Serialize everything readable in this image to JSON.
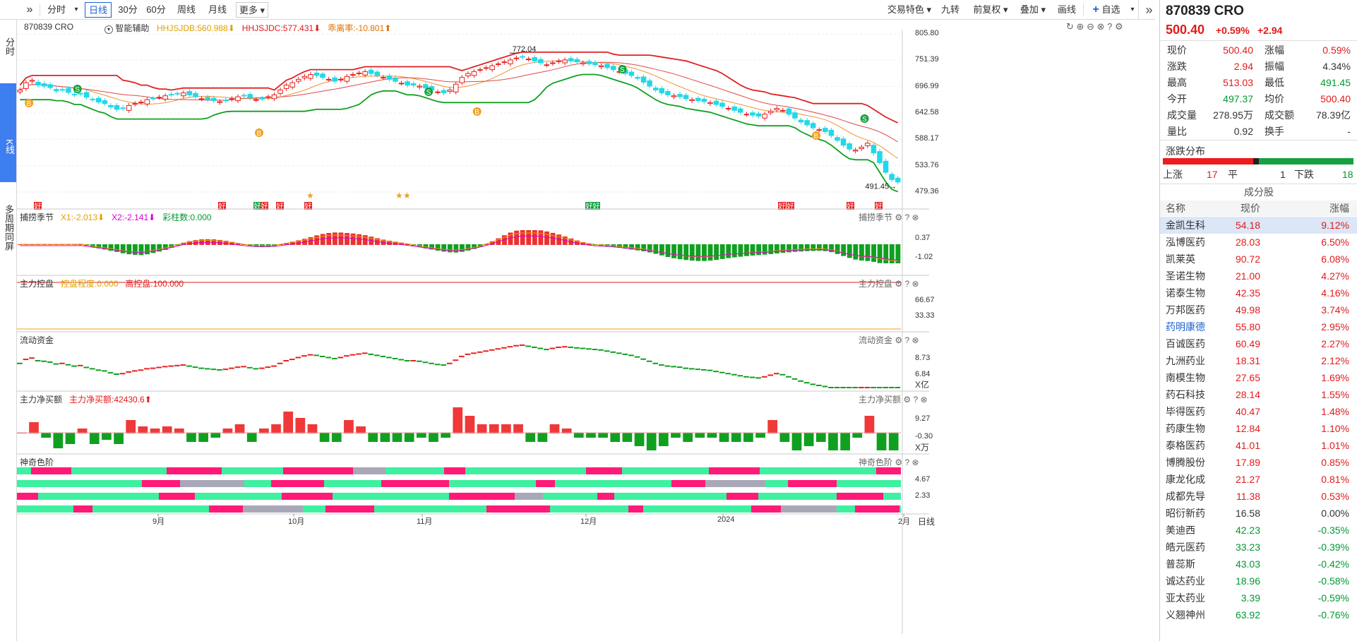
{
  "toolbar": {
    "expand_icon": "double-chevron-right-icon",
    "tabs": [
      {
        "label": "分时",
        "dropdown": true
      },
      {
        "label": "日线",
        "active": true
      },
      {
        "label": "30分"
      },
      {
        "label": "60分"
      },
      {
        "label": "周线"
      },
      {
        "label": "月线"
      },
      {
        "label": "更多",
        "dropdown": true
      }
    ],
    "right": [
      "交易特色",
      "九转",
      "前复权",
      "叠加",
      "画线",
      "自选"
    ],
    "add_icon": "plus-icon"
  },
  "left_tabs": [
    "分时",
    "K线",
    "多周期同屏"
  ],
  "main_panel": {
    "symbol": "870839 CRO",
    "assist_label": "智能辅助",
    "indicators": [
      {
        "text": "HHJSJDB:560.988",
        "color": "#e0a000",
        "arrow": "down"
      },
      {
        "text": "HHJSJDC:577.431",
        "color": "#e31a1a",
        "arrow": "down"
      },
      {
        "text": "乖离率:-10.801",
        "color": "#e07000",
        "arrow": "up"
      }
    ],
    "y_ticks": [
      "805.80",
      "751.39",
      "696.99",
      "642.58",
      "588.17",
      "533.76",
      "479.36"
    ],
    "high_label": "772.04",
    "low_label": "491.45"
  },
  "panels": [
    {
      "title": "捕捞季节",
      "title_color": "#333",
      "items": [
        {
          "text": "X1:-2.013",
          "color": "#e0a000",
          "arrow": "down"
        },
        {
          "text": "X2:-2.141",
          "color": "#d400d4",
          "arrow": "down"
        },
        {
          "text": "彩柱数:0.000",
          "color": "#009933"
        }
      ],
      "right_label": "捕捞季节",
      "y_ticks": [
        "0.37",
        "-1.02"
      ]
    },
    {
      "title": "主力控盘",
      "title_color": "#333",
      "items": [
        {
          "text": "控盘程度:0.000",
          "color": "#e0a000"
        },
        {
          "text": "高控盘:100.000",
          "color": "#e31a1a"
        }
      ],
      "right_label": "主力控盘",
      "y_ticks": [
        "66.67",
        "33.33"
      ]
    },
    {
      "title": "流动资金",
      "title_color": "#333",
      "items": [],
      "right_label": "流动资金",
      "y_ticks": [
        "8.73",
        "6.84"
      ],
      "unit": "X亿"
    },
    {
      "title": "主力净买额",
      "title_color": "#333",
      "items": [
        {
          "text": "主力净买额:42430.6",
          "color": "#e31a1a",
          "arrow": "up"
        }
      ],
      "right_label": "主力净买额",
      "y_ticks": [
        "9.27",
        "-0.30"
      ],
      "unit": "X万"
    },
    {
      "title": "神奇色阶",
      "title_color": "#333",
      "items": [],
      "right_label": "神奇色阶",
      "y_ticks": [
        "4.67",
        "2.33"
      ]
    }
  ],
  "good_marker": "好",
  "x_axis": [
    "9月",
    "10月",
    "11月",
    "12月",
    "2024",
    "2月"
  ],
  "x_period": "日线",
  "quote": {
    "code": "870839 CRO",
    "price": "500.40",
    "change_pct": "+0.59%",
    "change": "+2.94",
    "rows": [
      [
        {
          "label": "现价",
          "value": "500.40",
          "color": "red"
        },
        {
          "label": "涨幅",
          "value": "0.59%",
          "color": "red"
        }
      ],
      [
        {
          "label": "涨跌",
          "value": "2.94",
          "color": "red"
        },
        {
          "label": "振幅",
          "value": "4.34%",
          "color": "black"
        }
      ],
      [
        {
          "label": "最高",
          "value": "513.03",
          "color": "red"
        },
        {
          "label": "最低",
          "value": "491.45",
          "color": "green"
        }
      ],
      [
        {
          "label": "今开",
          "value": "497.37",
          "color": "green"
        },
        {
          "label": "均价",
          "value": "500.40",
          "color": "red"
        }
      ],
      [
        {
          "label": "成交量",
          "value": "278.95万",
          "color": "black"
        },
        {
          "label": "成交额",
          "value": "78.39亿",
          "color": "black"
        }
      ],
      [
        {
          "label": "量比",
          "value": "0.92",
          "color": "black"
        },
        {
          "label": "换手",
          "value": "-",
          "color": "black"
        }
      ]
    ],
    "dist_title": "涨跌分布",
    "dist": {
      "up_label": "上涨",
      "up": "17",
      "flat_label": "平",
      "flat": "1",
      "down_label": "下跌",
      "down": "18"
    },
    "cons_title": "成分股",
    "cons_headers": [
      "名称",
      "现价",
      "涨幅"
    ]
  },
  "constituents": [
    {
      "name": "金凯生科",
      "price": "54.18",
      "chg": "9.12%",
      "dir": "up",
      "hl": true
    },
    {
      "name": "泓博医药",
      "price": "28.03",
      "chg": "6.50%",
      "dir": "up"
    },
    {
      "name": "凯莱英",
      "price": "90.72",
      "chg": "6.08%",
      "dir": "up"
    },
    {
      "name": "圣诺生物",
      "price": "21.00",
      "chg": "4.27%",
      "dir": "up"
    },
    {
      "name": "诺泰生物",
      "price": "42.35",
      "chg": "4.16%",
      "dir": "up"
    },
    {
      "name": "万邦医药",
      "price": "49.98",
      "chg": "3.74%",
      "dir": "up"
    },
    {
      "name": "药明康德",
      "price": "55.80",
      "chg": "2.95%",
      "dir": "up",
      "name_blue": true
    },
    {
      "name": "百诚医药",
      "price": "60.49",
      "chg": "2.27%",
      "dir": "up"
    },
    {
      "name": "九洲药业",
      "price": "18.31",
      "chg": "2.12%",
      "dir": "up"
    },
    {
      "name": "南模生物",
      "price": "27.65",
      "chg": "1.69%",
      "dir": "up"
    },
    {
      "name": "药石科技",
      "price": "28.14",
      "chg": "1.55%",
      "dir": "up"
    },
    {
      "name": "毕得医药",
      "price": "40.47",
      "chg": "1.48%",
      "dir": "up"
    },
    {
      "name": "药康生物",
      "price": "12.84",
      "chg": "1.10%",
      "dir": "up"
    },
    {
      "name": "泰格医药",
      "price": "41.01",
      "chg": "1.01%",
      "dir": "up"
    },
    {
      "name": "博腾股份",
      "price": "17.89",
      "chg": "0.85%",
      "dir": "up"
    },
    {
      "name": "康龙化成",
      "price": "21.27",
      "chg": "0.81%",
      "dir": "up"
    },
    {
      "name": "成都先导",
      "price": "11.38",
      "chg": "0.53%",
      "dir": "up"
    },
    {
      "name": "昭衍新药",
      "price": "16.58",
      "chg": "0.00%",
      "dir": "flat"
    },
    {
      "name": "美迪西",
      "price": "42.23",
      "chg": "-0.35%",
      "dir": "down"
    },
    {
      "name": "皓元医药",
      "price": "33.23",
      "chg": "-0.39%",
      "dir": "down"
    },
    {
      "name": "普蕊斯",
      "price": "43.03",
      "chg": "-0.42%",
      "dir": "down"
    },
    {
      "name": "诚达药业",
      "price": "18.96",
      "chg": "-0.58%",
      "dir": "down"
    },
    {
      "name": "亚太药业",
      "price": "3.39",
      "chg": "-0.59%",
      "dir": "down"
    },
    {
      "name": "义翘神州",
      "price": "63.92",
      "chg": "-0.76%",
      "dir": "down"
    }
  ],
  "chart_data": {
    "type": "candlestick",
    "y_range": [
      479.36,
      805.8
    ],
    "x_labels": [
      "9月",
      "10月",
      "11月",
      "12月",
      "2024",
      "2月"
    ],
    "closes": [
      690,
      705,
      710,
      700,
      698,
      695,
      688,
      690,
      685,
      680,
      682,
      675,
      670,
      665,
      662,
      655,
      650,
      652,
      658,
      662,
      665,
      670,
      672,
      675,
      678,
      680,
      682,
      684,
      680,
      676,
      672,
      670,
      668,
      666,
      668,
      672,
      676,
      678,
      674,
      670,
      672,
      676,
      680,
      690,
      700,
      705,
      712,
      718,
      722,
      720,
      716,
      712,
      708,
      712,
      718,
      722,
      725,
      728,
      724,
      720,
      716,
      712,
      708,
      704,
      700,
      700,
      698,
      694,
      690,
      686,
      684,
      690,
      702,
      716,
      724,
      728,
      732,
      736,
      740,
      744,
      748,
      752,
      756,
      758,
      754,
      750,
      746,
      742,
      746,
      750,
      752,
      750,
      748,
      746,
      744,
      742,
      740,
      736,
      732,
      728,
      724,
      720,
      714,
      706,
      698,
      690,
      684,
      680,
      678,
      676,
      672,
      670,
      668,
      666,
      664,
      660,
      656,
      652,
      648,
      644,
      640,
      638,
      636,
      640,
      646,
      652,
      648,
      640,
      632,
      624,
      618,
      612,
      608,
      604,
      596,
      586,
      576,
      568,
      566,
      572,
      580,
      560,
      540,
      520,
      505,
      500
    ],
    "high": 772.04,
    "low": 491.45
  }
}
